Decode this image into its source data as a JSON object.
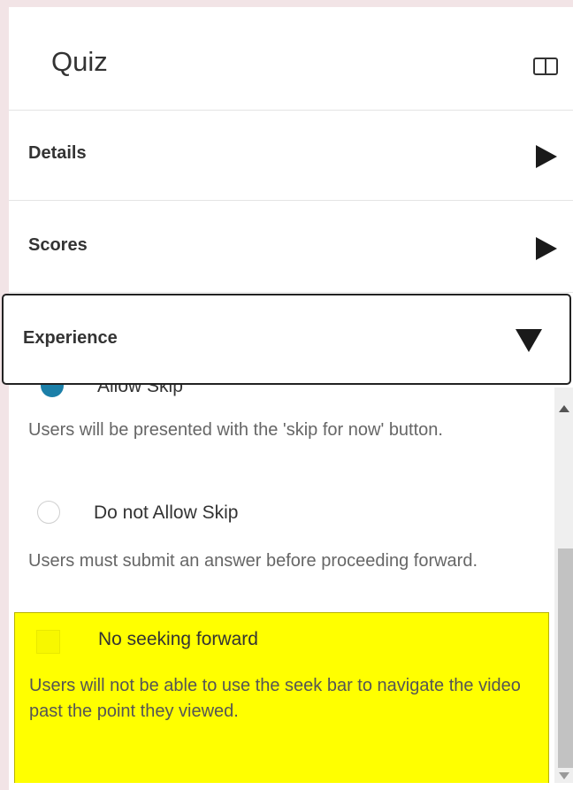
{
  "panel": {
    "title": "Quiz",
    "layout_icon": "panel-layout-icon"
  },
  "sections": [
    {
      "label": "Details",
      "state": "collapsed",
      "icon": "triangle-right-icon"
    },
    {
      "label": "Scores",
      "state": "collapsed",
      "icon": "triangle-right-icon"
    },
    {
      "label": "Experience",
      "state": "expanded",
      "icon": "triangle-down-icon"
    }
  ],
  "experience": {
    "options": [
      {
        "label": "Allow Skip",
        "checked": true,
        "description": "Users will be presented with the 'skip for now' button."
      },
      {
        "label": "Do not Allow Skip",
        "checked": false,
        "description": "Users must submit an answer before proceeding forward."
      }
    ],
    "no_seek": {
      "label": "No seeking forward",
      "checked": false,
      "description": "Users will not be able to use the seek bar to navigate the video past the point they viewed."
    }
  },
  "colors": {
    "highlight": "#ffff00",
    "radio_checked": "#1b7fa8",
    "background": "#f2e4e6"
  }
}
